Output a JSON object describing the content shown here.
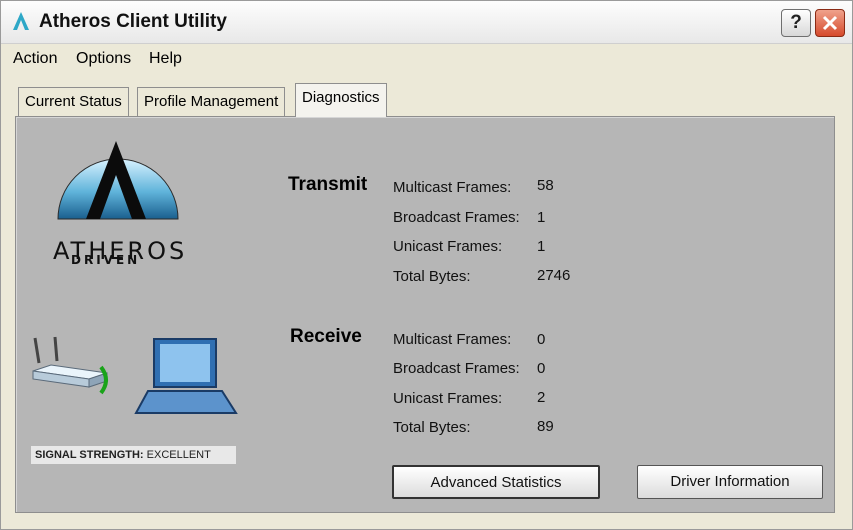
{
  "window": {
    "title": "Atheros Client Utility"
  },
  "titlebar": {
    "help_label": "?"
  },
  "menu": {
    "items": [
      "Action",
      "Options",
      "Help"
    ]
  },
  "tabs": [
    {
      "label": "Current Status"
    },
    {
      "label": "Profile Management"
    },
    {
      "label": "Diagnostics"
    }
  ],
  "brand": {
    "line1": "ATHEROS",
    "line2": "DRIVEN"
  },
  "transmit": {
    "title": "Transmit",
    "rows": [
      {
        "label": "Multicast Frames:",
        "value": "58"
      },
      {
        "label": "Broadcast Frames:",
        "value": "1"
      },
      {
        "label": "Unicast Frames:",
        "value": "1"
      },
      {
        "label": "Total Bytes:",
        "value": "2746"
      }
    ]
  },
  "receive": {
    "title": "Receive",
    "rows": [
      {
        "label": "Multicast Frames:",
        "value": "0"
      },
      {
        "label": "Broadcast Frames:",
        "value": "0"
      },
      {
        "label": "Unicast Frames:",
        "value": "2"
      },
      {
        "label": "Total Bytes:",
        "value": "89"
      }
    ]
  },
  "signal": {
    "label": "SIGNAL STRENGTH:",
    "value": "EXCELLENT"
  },
  "buttons": {
    "advanced": "Advanced Statistics",
    "driver": "Driver Information"
  },
  "colors": {
    "panel": "#b6b6b6",
    "close": "#d64a2c",
    "signal_arc": "#19a319"
  }
}
